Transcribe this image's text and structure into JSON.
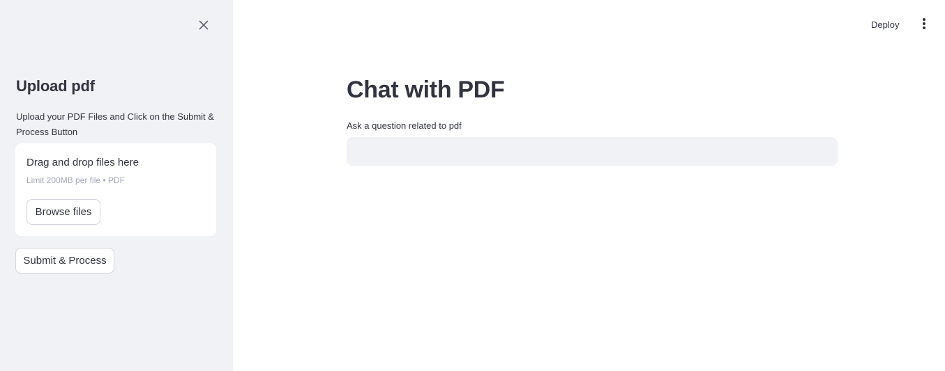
{
  "sidebar": {
    "close_icon": "close-icon",
    "title": "Upload pdf",
    "description": "Upload your PDF Files and Click on the Submit & Process Button",
    "uploader": {
      "title": "Drag and drop files here",
      "limit": "Limit 200MB per file • PDF",
      "browse_label": "Browse files"
    },
    "submit_label": "Submit & Process"
  },
  "header": {
    "deploy_label": "Deploy",
    "menu_icon": "kebab-menu-icon"
  },
  "main": {
    "title": "Chat with PDF",
    "input_label": "Ask a question related to pdf",
    "input_value": ""
  },
  "colors": {
    "sidebar_bg": "#f0f2f6",
    "text": "#31333f",
    "muted_text": "#a3a8b8",
    "input_bg": "#f0f2f6",
    "button_border": "#d3d5dc"
  }
}
